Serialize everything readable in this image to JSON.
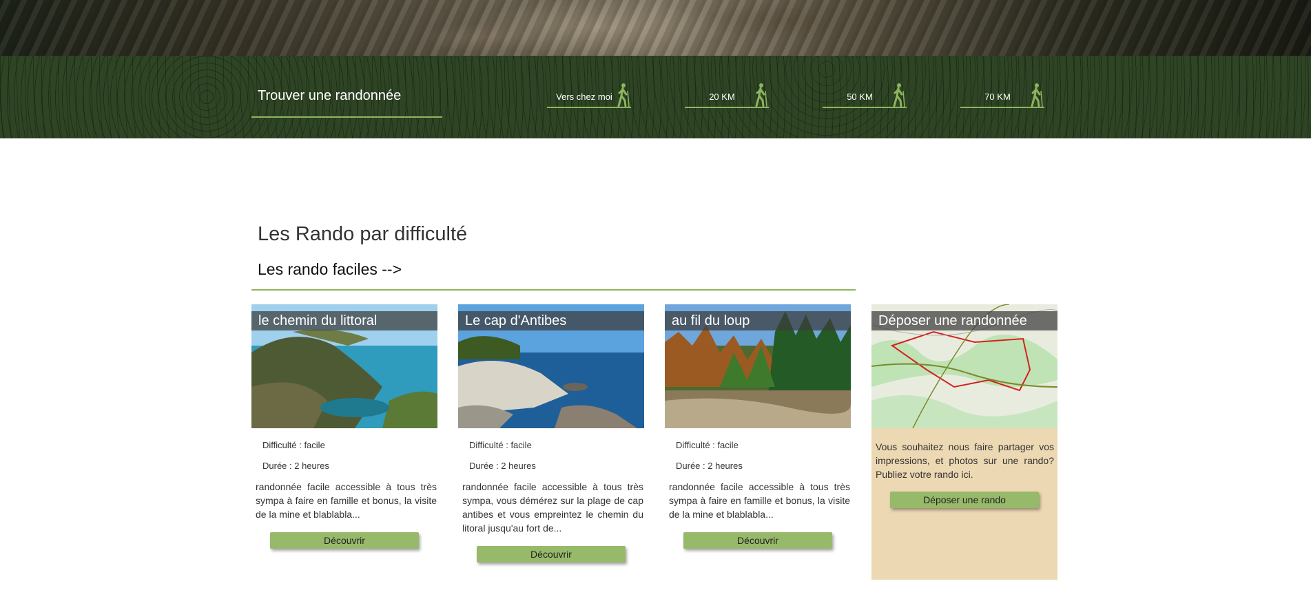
{
  "search": {
    "title": "Trouver une randonnée",
    "distances": [
      {
        "label": "Vers chez moi"
      },
      {
        "label": "20 KM"
      },
      {
        "label": "50 KM"
      },
      {
        "label": "70 KM"
      }
    ]
  },
  "section": {
    "title": "Les Rando par difficulté",
    "subtitle": "Les rando faciles -->"
  },
  "cards": [
    {
      "title": "le chemin du littoral",
      "difficulty": "Difficulté : facile",
      "duration": "Durée : 2 heures",
      "description": "randonnée facile accessible à tous très sympa à faire en famille et bonus, la visite de la mine et blablabla...",
      "button": "Découvrir"
    },
    {
      "title": "Le cap d'Antibes",
      "difficulty": "Difficulté : facile",
      "duration": "Durée : 2 heures",
      "description": "randonnée facile accessible à tous très sympa, vous démérez sur la plage de cap antibes et vous empreintez le chemin du litoral jusqu'au fort de...",
      "button": "Découvrir"
    },
    {
      "title": "au fil du loup",
      "difficulty": "Difficulté : facile",
      "duration": "Durée : 2 heures",
      "description": "randonnée facile accessible à tous très sympa à faire en famille et bonus, la visite de la mine et blablabla...",
      "button": "Découvrir"
    }
  ],
  "submit": {
    "title": "Déposer une randonnée",
    "description": "Vous souhaitez nous faire partager vos impressions, et photos sur une rando? Publiez votre rando ici.",
    "button": "Déposer une rando"
  },
  "colors": {
    "accent_green": "#8db55e",
    "button_green": "#97b96a",
    "band_green": "#2e4424",
    "submit_bg": "#ecd8b2"
  },
  "icons": {
    "distance": "hiker-icon"
  }
}
